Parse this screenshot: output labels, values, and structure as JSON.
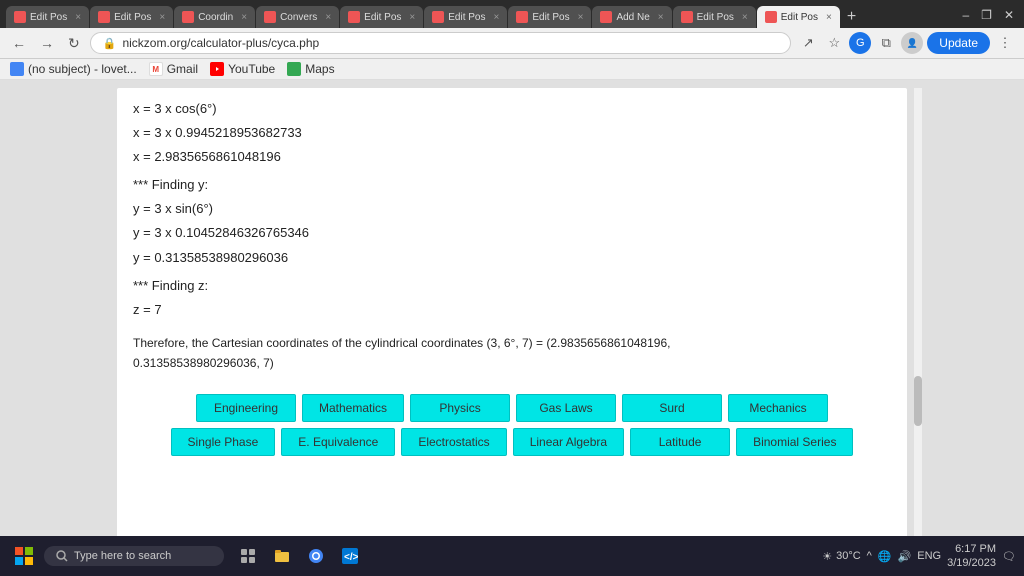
{
  "browser": {
    "tabs": [
      {
        "label": "Edit Pos",
        "active": false
      },
      {
        "label": "Edit Pos",
        "active": false
      },
      {
        "label": "Coordin",
        "active": false
      },
      {
        "label": "Convers",
        "active": false
      },
      {
        "label": "Edit Pos",
        "active": false
      },
      {
        "label": "Edit Pos",
        "active": false
      },
      {
        "label": "Edit Pos",
        "active": false
      },
      {
        "label": "Add Ne",
        "active": false
      },
      {
        "label": "Edit Pos",
        "active": false
      },
      {
        "label": "Edit Pos",
        "active": true
      }
    ],
    "address": "nickzom.org/calculator-plus/cyca.php",
    "update_btn": "Update"
  },
  "bookmarks": [
    {
      "label": "(no subject) - lovet...",
      "icon": "email"
    },
    {
      "label": "Gmail",
      "icon": "gmail"
    },
    {
      "label": "YouTube",
      "icon": "youtube"
    },
    {
      "label": "Maps",
      "icon": "maps"
    }
  ],
  "content": {
    "line1": "x = 3 x cos(6°)",
    "line2": "x = 3 x 0.9945218953682733",
    "line3": "x = 2.9835656861048196",
    "line4": "*** Finding y:",
    "line5": "y = 3 x sin(6°)",
    "line6": "y = 3 x 0.10452846326765346",
    "line7": "y = 0.31358538980296036",
    "line8": "*** Finding z:",
    "line9": "z = 7",
    "conclusion": "Therefore, the Cartesian coordinates of the cylindrical coordinates (3, 6°, 7) = (2.9835656861048196, 0.31358538980296036, 7)"
  },
  "buttons_row1": [
    {
      "label": "Engineering"
    },
    {
      "label": "Mathematics"
    },
    {
      "label": "Physics"
    },
    {
      "label": "Gas Laws"
    },
    {
      "label": "Surd"
    },
    {
      "label": "Mechanics"
    }
  ],
  "buttons_row2": [
    {
      "label": "Single Phase"
    },
    {
      "label": "E. Equivalence"
    },
    {
      "label": "Electrostatics"
    },
    {
      "label": "Linear Algebra"
    },
    {
      "label": "Latitude"
    },
    {
      "label": "Binomial Series"
    }
  ],
  "taskbar": {
    "search_placeholder": "Type here to search",
    "weather": "30°C",
    "time": "6:17 PM",
    "date": "3/19/2023",
    "lang": "ENG"
  }
}
